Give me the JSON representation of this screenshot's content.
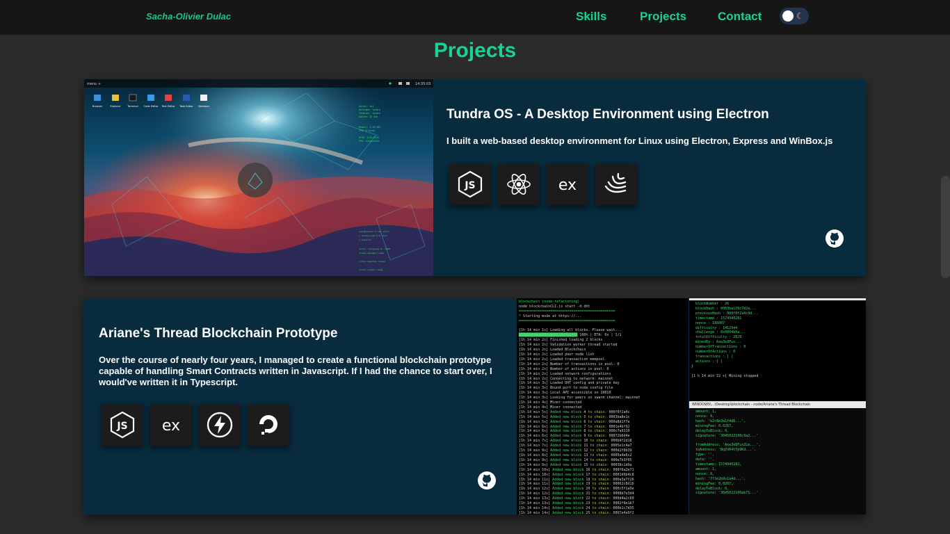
{
  "navbar": {
    "brand": "Sacha-Olivier Dulac",
    "links": [
      {
        "label": "Skills"
      },
      {
        "label": "Projects"
      },
      {
        "label": "Contact"
      }
    ],
    "theme_toggle": {
      "state": "dark",
      "icon": "moon-icon"
    }
  },
  "section": {
    "title": "Projects"
  },
  "projects": [
    {
      "title": "Tundra OS - A Desktop Environment using Electron",
      "description": "I built a web-based desktop environment for Linux using Electron, Express and WinBox.js",
      "tech_icons": [
        "nodejs-icon",
        "electron-icon",
        "express-icon",
        "winbox-icon"
      ],
      "github_icon": "github-icon",
      "screenshot": {
        "taskbar_left": "menu +",
        "clock": "14:35:03",
        "desktop_icons": [
          "Browser",
          "Explorer",
          "Terminal",
          "Code Editor",
          "Text Editor",
          "Task Editor",
          "Notepad"
        ]
      }
    },
    {
      "title": "Ariane's Thread Blockchain Prototype",
      "description": "Over the course of nearly four years, I managed to create a functional blockchain prototype capable of handling Smart Contracts written in Javascript. If I had the chance to start over, I would've written it in Typescript.",
      "tech_icons": [
        "nodejs-icon",
        "express-icon",
        "socketio-icon",
        "digitalocean-icon"
      ],
      "github_icon": "github-icon",
      "screenshot": {
        "left_terminal_header": "node blockchainCLI.js start -d dht",
        "left_terminal_status": "Starting mode at https://...",
        "right_terminal_footer": "[1 h 14 min 22 s] Mining stopped",
        "window_title": "WINDOWS\\...\\Desktop\\blockchain - node/Ariane's Thread Blockchain"
      }
    }
  ]
}
